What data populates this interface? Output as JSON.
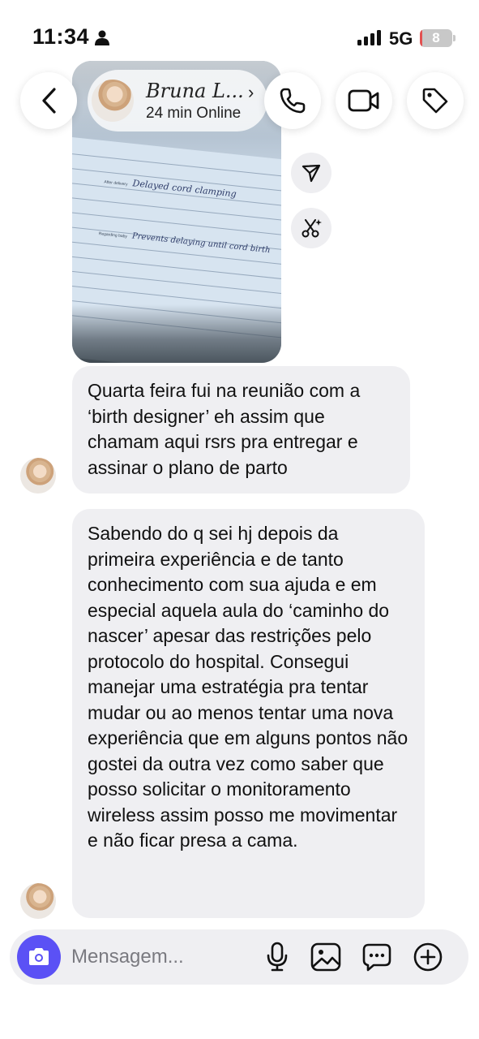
{
  "status_bar": {
    "time": "11:34",
    "network": "5G",
    "battery_level": "8",
    "battery_fraction": 0.08
  },
  "header": {
    "contact_name": "Bruna L...",
    "contact_status": "24 min  Online"
  },
  "photo": {
    "line_1": "Delayed cord clamping",
    "line_1_label": "After delivery",
    "line_2": "Prevents delaying until cord birth",
    "line_2_label": "Regarding baby"
  },
  "messages": [
    {
      "text": "Quarta feira fui na reunião com a ‘birth designer’ eh assim que chamam aqui rsrs pra entregar e assinar o plano de parto"
    },
    {
      "text": "Sabendo do q sei hj depois da primeira experiência e de tanto conhecimento com sua ajuda e em especial aquela aula do ‘caminho do nascer’ apesar das restrições pelo protocolo do hospital. Consegui manejar uma estratégia pra tentar mudar ou ao menos tentar uma nova experiência que em alguns pontos não gostei da outra vez como saber que posso solicitar o monitoramento wireless assim posso me movimentar e não ficar presa a cama."
    }
  ],
  "composer": {
    "placeholder": "Mensagem...",
    "value": ""
  },
  "icons": {
    "back": "chevron-left-icon",
    "call": "phone-icon",
    "video": "video-camera-icon",
    "tag": "tag-icon",
    "share": "send-icon",
    "ai": "sparkle-scissors-icon",
    "camera": "camera-icon",
    "mic": "microphone-icon",
    "gallery": "image-icon",
    "sticker": "chat-bubble-icon",
    "plus": "plus-circle-icon"
  },
  "colors": {
    "accent": "#5b51f5",
    "bubble": "#efeff2",
    "battery_low": "#e35151"
  }
}
